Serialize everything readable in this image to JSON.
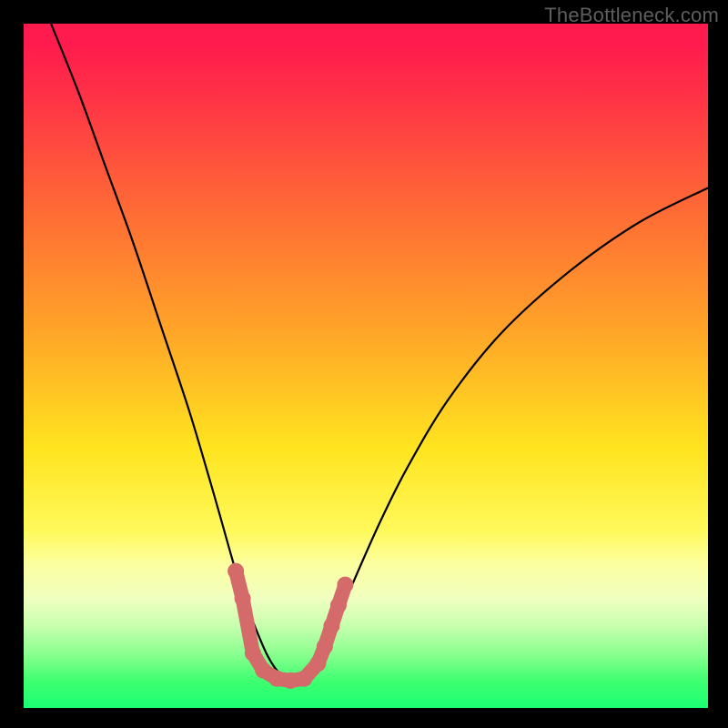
{
  "watermark": "TheBottleneck.com",
  "chart_data": {
    "type": "line",
    "title": "",
    "xlabel": "",
    "ylabel": "",
    "xlim": [
      0,
      100
    ],
    "ylim": [
      0,
      100
    ],
    "series": [
      {
        "name": "bottleneck-curve",
        "x": [
          4,
          8,
          12,
          16,
          20,
          24,
          27,
          29,
          31,
          33,
          35,
          36,
          37,
          38,
          39,
          40,
          41,
          42,
          43,
          45,
          48,
          52,
          56,
          62,
          70,
          80,
          90,
          100
        ],
        "y": [
          100,
          90,
          79,
          68,
          56,
          44,
          34,
          27,
          20,
          14,
          9,
          7,
          5.5,
          4.5,
          4,
          4,
          4.5,
          5.5,
          7,
          11,
          18,
          27,
          35,
          45,
          55,
          64,
          71,
          76
        ]
      }
    ],
    "markers": {
      "name": "highlight-region",
      "color": "#d46a6a",
      "points": [
        {
          "x": 31,
          "y": 20
        },
        {
          "x": 32,
          "y": 16
        },
        {
          "x": 33.5,
          "y": 8
        },
        {
          "x": 35,
          "y": 5.5
        },
        {
          "x": 37,
          "y": 4.3
        },
        {
          "x": 39,
          "y": 4
        },
        {
          "x": 41,
          "y": 4.3
        },
        {
          "x": 43,
          "y": 6.5
        },
        {
          "x": 44,
          "y": 9
        },
        {
          "x": 45,
          "y": 12
        },
        {
          "x": 46,
          "y": 15
        },
        {
          "x": 47,
          "y": 18
        }
      ]
    },
    "gradient_stops": [
      {
        "pos": 0,
        "color": "#ff1b4d"
      },
      {
        "pos": 27,
        "color": "#ff6a36"
      },
      {
        "pos": 62,
        "color": "#ffe41f"
      },
      {
        "pos": 84,
        "color": "#f0ffc0"
      },
      {
        "pos": 100,
        "color": "#1aff72"
      }
    ]
  }
}
